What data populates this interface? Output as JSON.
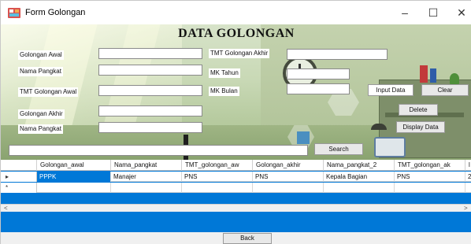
{
  "window": {
    "title": "Form Golongan",
    "minimize_glyph": "–",
    "maximize_glyph": "☐",
    "close_glyph": "✕",
    "app_icon": "form-app-icon"
  },
  "form": {
    "heading": "DATA GOLONGAN",
    "labels": {
      "golongan_awal": "Golongan Awal",
      "nama_pangkat": "Nama Pangkat",
      "tmt_golongan_awal": "TMT Golongan Awal",
      "golongan_akhir": "Golongan Akhir",
      "nama_pangkat_2": "Nama Pangkat",
      "tmt_golongan_akhir": "TMT Golongan Akhir",
      "mk_tahun": "MK Tahun",
      "mk_bulan": "MK Bulan"
    },
    "values": {
      "golongan_awal": "",
      "nama_pangkat": "",
      "tmt_golongan_awal": "",
      "golongan_akhir": "",
      "nama_pangkat_2": "",
      "tmt_golongan_akhir": "",
      "mk_tahun": "",
      "mk_bulan": "",
      "search": ""
    },
    "buttons": {
      "input_data": "Input Data",
      "clear": "Clear",
      "delete": "Delete",
      "display_data": "Display Data",
      "search": "Search",
      "back": "Back"
    }
  },
  "grid": {
    "columns": [
      "Golongan_awal",
      "Nama_pangkat",
      "TMT_golongan_aw",
      "Golongan_akhir",
      "Nama_pangkat_2",
      "TMT_golongan_ak",
      "l"
    ],
    "rows": [
      {
        "marker": "▸",
        "cells": [
          "PPPK",
          "Manajer",
          "PNS",
          "PNS",
          "Kepala Bagian",
          "PNS",
          "2"
        ]
      },
      {
        "marker": "*",
        "cells": [
          "",
          "",
          "",
          "",
          "",
          "",
          ""
        ]
      }
    ],
    "scroll_left": "<",
    "scroll_right": ">"
  },
  "colors": {
    "selection": "#0078d7",
    "grid_background": "#0078d7"
  }
}
